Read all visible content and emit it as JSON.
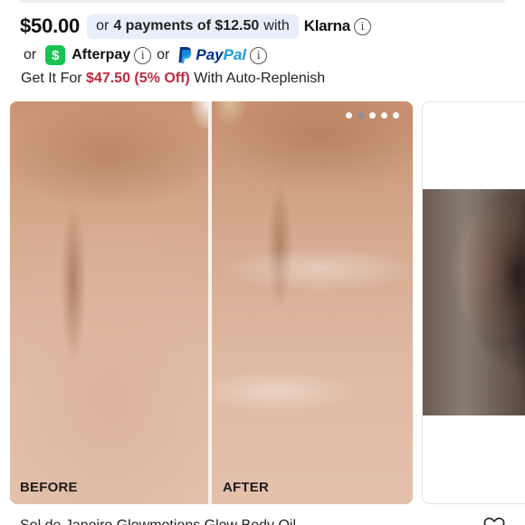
{
  "price": {
    "amount": "$50.00",
    "installments_prefix": "or",
    "installments_strong": "4 payments of $12.50",
    "installments_suffix": "with",
    "klarna_label": "Klarna"
  },
  "payment_alternatives": {
    "or_1": "or",
    "afterpay_label": "Afterpay",
    "or_2": "or",
    "paypal_pay": "Pay",
    "paypal_pal": "Pal"
  },
  "auto_replenish": {
    "prefix": "Get It For",
    "discount_price": "$47.50 (5% Off)",
    "suffix": "With Auto-Replenish"
  },
  "gallery": {
    "before_label": "BEFORE",
    "after_label": "AFTER",
    "dots_total": 5,
    "active_dot_index": 1
  },
  "icons": {
    "info": "info-icon",
    "cash_app": "cash-app-icon",
    "paypal": "paypal-icon",
    "heart": "heart-icon"
  },
  "colors": {
    "klarna_pill_bg": "#e8effb",
    "discount_red": "#c0283e",
    "cash_app_green": "#19c352",
    "paypal_blue_dark": "#003087",
    "paypal_blue_light": "#1a9be0"
  },
  "footer": {
    "partial_text": "Sol de Janeiro Glowmotions Glow Body Oil"
  }
}
